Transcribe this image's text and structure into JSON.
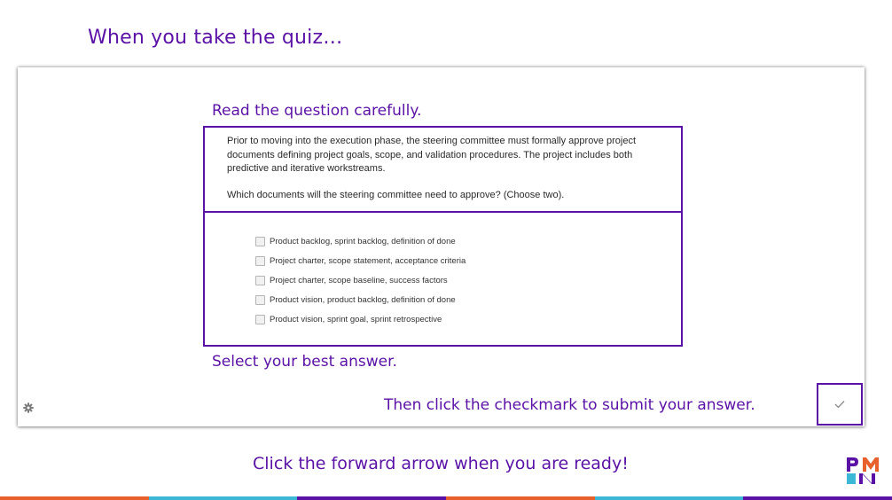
{
  "slide": {
    "title": "When you take the quiz…",
    "footer": "Click the forward arrow when you are ready!"
  },
  "hints": {
    "read": "Read the question carefully.",
    "select": "Select your best answer.",
    "submit": "Then click the checkmark to submit your answer."
  },
  "question": {
    "text": "Prior to moving into the execution phase, the steering committee must formally approve project documents defining project goals, scope, and validation procedures. The project includes both predictive and iterative workstreams.",
    "prompt": "Which documents will the steering committee need to approve? (Choose two)."
  },
  "options": [
    {
      "label": "Product backlog,  sprint backlog,  definition of done",
      "checked": false
    },
    {
      "label": "Project charter, scope statement, acceptance criteria",
      "checked": false
    },
    {
      "label": "Project charter, scope baseline, success factors",
      "checked": false
    },
    {
      "label": "Product vision,  product backlog,  definition of done",
      "checked": false
    },
    {
      "label": "Product vision, sprint goal, sprint retrospective",
      "checked": false
    }
  ],
  "icons": {
    "settings": "gear-icon",
    "submit": "checkmark-icon",
    "logo": "pmi-logo"
  },
  "colors": {
    "accent": "#5a12a6",
    "bar": [
      "#e8612c",
      "#3cb8d6",
      "#5a12a6",
      "#e8612c",
      "#3cb8d6",
      "#5a12a6"
    ]
  }
}
